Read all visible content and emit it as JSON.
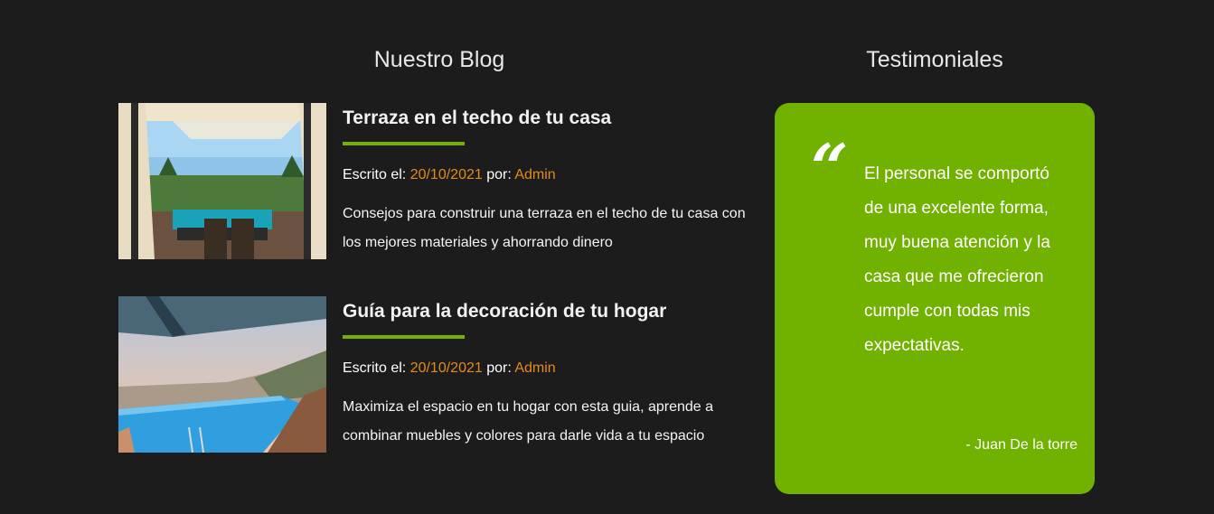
{
  "blog": {
    "title": "Nuestro Blog",
    "posts": [
      {
        "title": "Terraza en el techo de tu casa",
        "meta_written": "Escrito el: ",
        "date": "20/10/2021",
        "meta_by": " por: ",
        "author": "Admin",
        "excerpt": "Consejos para construir una terraza en el techo de tu casa con los mejores materiales y ahorrando dinero",
        "image": "rooftop-terrace-photo"
      },
      {
        "title": "Guía para la decoración de tu hogar",
        "meta_written": "Escrito el: ",
        "date": "20/10/2021",
        "meta_by": " por: ",
        "author": "Admin",
        "excerpt": "Maximiza el espacio en tu hogar con esta guia, aprende a combinar muebles y colores para darle vida a tu espacio",
        "image": "infinity-pool-photo"
      }
    ]
  },
  "testimonials": {
    "title": "Testimoniales",
    "quote_mark": "“",
    "quote": "El personal se comportó de una excelente forma, muy buena atención y la casa que me ofrecieron cumple con todas mis expectativas.",
    "author": "- Juan De la torre"
  },
  "colors": {
    "background": "#1c1c1c",
    "accent_green": "#71b100",
    "accent_orange": "#e58a1a"
  }
}
